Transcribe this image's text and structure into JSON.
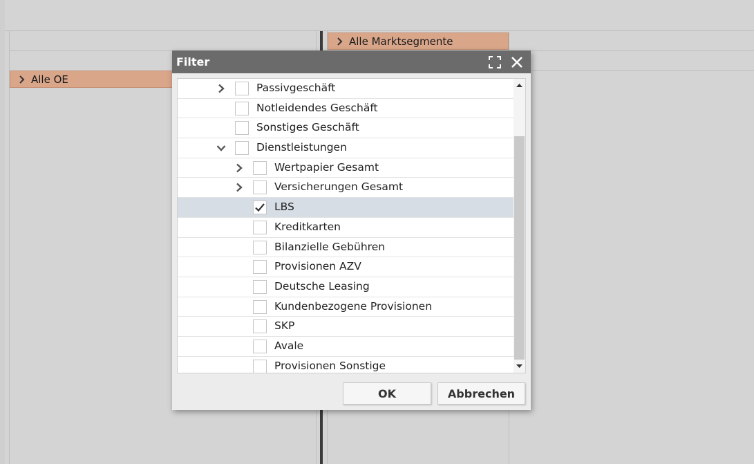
{
  "background": {
    "segment_right_label": "Alle Marktsegmente",
    "segment_left_label": "Alle OE"
  },
  "dialog": {
    "title": "Filter",
    "ok_label": "OK",
    "cancel_label": "Abbrechen",
    "items": [
      {
        "label": "Passivgeschäft",
        "level": 1,
        "expander": "collapsed",
        "checked": false,
        "selected": false
      },
      {
        "label": "Notleidendes Geschäft",
        "level": 1,
        "expander": "none",
        "checked": false,
        "selected": false
      },
      {
        "label": "Sonstiges Geschäft",
        "level": 1,
        "expander": "none",
        "checked": false,
        "selected": false
      },
      {
        "label": "Dienstleistungen",
        "level": 1,
        "expander": "expanded",
        "checked": false,
        "selected": false
      },
      {
        "label": "Wertpapier Gesamt",
        "level": 2,
        "expander": "collapsed",
        "checked": false,
        "selected": false
      },
      {
        "label": "Versicherungen Gesamt",
        "level": 2,
        "expander": "collapsed",
        "checked": false,
        "selected": false
      },
      {
        "label": "LBS",
        "level": 2,
        "expander": "none",
        "checked": true,
        "selected": true
      },
      {
        "label": "Kreditkarten",
        "level": 2,
        "expander": "none",
        "checked": false,
        "selected": false
      },
      {
        "label": "Bilanzielle Gebühren",
        "level": 2,
        "expander": "none",
        "checked": false,
        "selected": false
      },
      {
        "label": "Provisionen AZV",
        "level": 2,
        "expander": "none",
        "checked": false,
        "selected": false
      },
      {
        "label": "Deutsche Leasing",
        "level": 2,
        "expander": "none",
        "checked": false,
        "selected": false
      },
      {
        "label": "Kundenbezogene Provisionen",
        "level": 2,
        "expander": "none",
        "checked": false,
        "selected": false
      },
      {
        "label": "SKP",
        "level": 2,
        "expander": "none",
        "checked": false,
        "selected": false
      },
      {
        "label": "Avale",
        "level": 2,
        "expander": "none",
        "checked": false,
        "selected": false
      },
      {
        "label": "Provisionen Sonstige",
        "level": 2,
        "expander": "none",
        "checked": false,
        "selected": false
      }
    ]
  },
  "colors": {
    "segment_fill": "#d9a68a",
    "titlebar": "#6b6b6b",
    "selected_row": "#d7dde5"
  }
}
